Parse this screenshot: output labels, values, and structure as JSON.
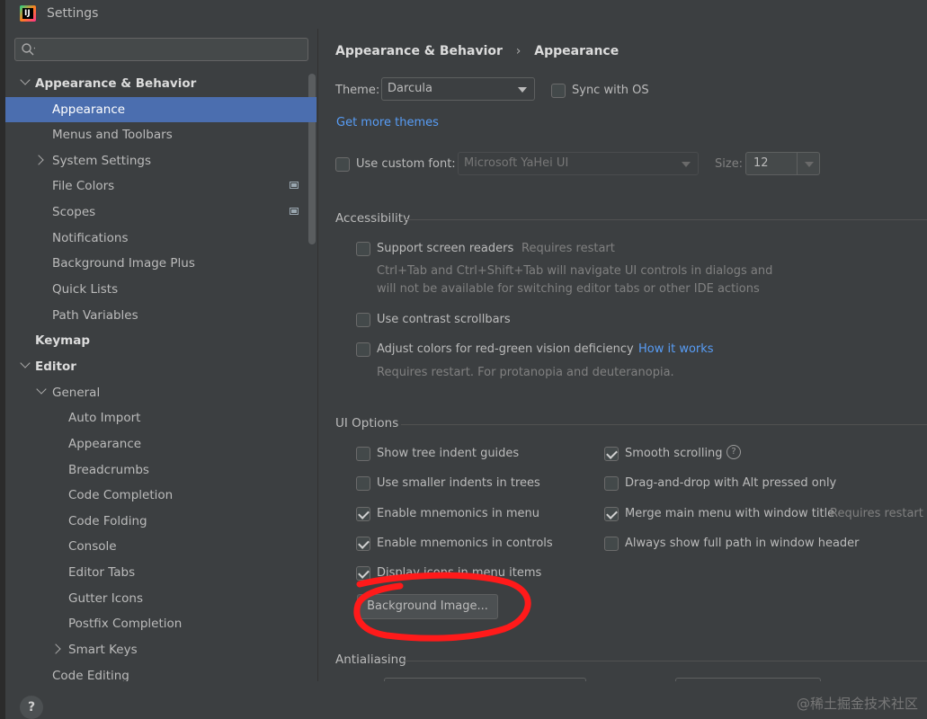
{
  "window": {
    "title": "Settings",
    "logo_text": "IJ"
  },
  "sidebar": {
    "search_placeholder": "",
    "items": [
      {
        "label": "Appearance & Behavior"
      },
      {
        "label": "Appearance"
      },
      {
        "label": "Menus and Toolbars"
      },
      {
        "label": "System Settings"
      },
      {
        "label": "File Colors"
      },
      {
        "label": "Scopes"
      },
      {
        "label": "Notifications"
      },
      {
        "label": "Background Image Plus"
      },
      {
        "label": "Quick Lists"
      },
      {
        "label": "Path Variables"
      },
      {
        "label": "Keymap"
      },
      {
        "label": "Editor"
      },
      {
        "label": "General"
      },
      {
        "label": "Auto Import"
      },
      {
        "label": "Appearance"
      },
      {
        "label": "Breadcrumbs"
      },
      {
        "label": "Code Completion"
      },
      {
        "label": "Code Folding"
      },
      {
        "label": "Console"
      },
      {
        "label": "Editor Tabs"
      },
      {
        "label": "Gutter Icons"
      },
      {
        "label": "Postfix Completion"
      },
      {
        "label": "Smart Keys"
      },
      {
        "label": "Code Editing"
      }
    ]
  },
  "breadcrumb": {
    "parent": "Appearance & Behavior",
    "separator": "›",
    "current": "Appearance"
  },
  "theme": {
    "label": "Theme:",
    "value": "Darcula",
    "sync_label": "Sync with OS",
    "sync_checked": false,
    "more_link": "Get more themes"
  },
  "font": {
    "label": "Use custom font:",
    "checked": false,
    "value": "Microsoft YaHei UI",
    "size_label": "Size:",
    "size_value": "12"
  },
  "accessibility": {
    "title": "Accessibility",
    "screen_readers": {
      "label": "Support screen readers",
      "note": "Requires restart",
      "checked": false,
      "desc1": "Ctrl+Tab and Ctrl+Shift+Tab will navigate UI controls in dialogs and",
      "desc2": "will not be available for switching editor tabs or other IDE actions"
    },
    "contrast": {
      "label": "Use contrast scrollbars",
      "checked": false
    },
    "red_green": {
      "label": "Adjust colors for red-green vision deficiency",
      "link": "How it works",
      "checked": false,
      "desc": "Requires restart. For protanopia and deuteranopia."
    }
  },
  "ui_options": {
    "title": "UI Options",
    "tree_indent": {
      "label": "Show tree indent guides",
      "checked": false
    },
    "smaller_indents": {
      "label": "Use smaller indents in trees",
      "checked": false
    },
    "mnemonics_menu": {
      "label": "Enable mnemonics in menu",
      "checked": true
    },
    "mnemonics_controls": {
      "label": "Enable mnemonics in controls",
      "checked": true
    },
    "icons_menu": {
      "label": "Display icons in menu items",
      "checked": true
    },
    "smooth_scrolling": {
      "label": "Smooth scrolling",
      "checked": true,
      "help": "?"
    },
    "drag_drop": {
      "label": "Drag-and-drop with Alt pressed only",
      "checked": false
    },
    "merge_menu": {
      "label": "Merge main menu with window title",
      "note": "Requires restart",
      "checked": true
    },
    "full_path": {
      "label": "Always show full path in window header",
      "checked": false
    },
    "background_button": "Background Image..."
  },
  "antialiasing": {
    "title": "Antialiasing"
  },
  "bottom": {
    "help": "?",
    "watermark": "@稀土掘金技术社区"
  },
  "colors": {
    "selection": "#4b6eaf",
    "link": "#589df6",
    "annotation": "#ff0000"
  }
}
